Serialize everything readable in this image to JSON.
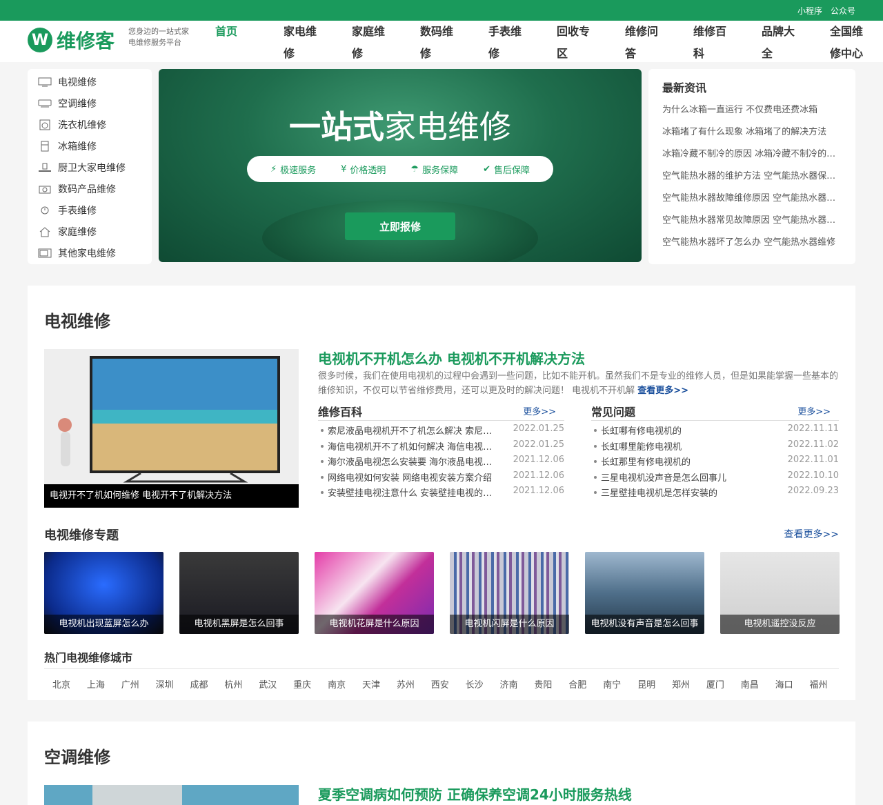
{
  "topbar": {
    "miniprogram": "小程序",
    "official": "公众号"
  },
  "brand": {
    "logo_letter": "W",
    "name": "维修客",
    "slogan": "您身边的一站式家电维修服务平台"
  },
  "nav": [
    "首页",
    "家电维修",
    "家庭维修",
    "数码维修",
    "手表维修",
    "回收专区",
    "维修问答",
    "维修百科",
    "品牌大全",
    "全国维修中心"
  ],
  "categories": [
    {
      "icon": "tv-icon",
      "label": "电视维修"
    },
    {
      "icon": "air-conditioner-icon",
      "label": "空调维修"
    },
    {
      "icon": "washing-machine-icon",
      "label": "洗衣机维修"
    },
    {
      "icon": "fridge-icon",
      "label": "冰箱维修"
    },
    {
      "icon": "stove-icon",
      "label": "厨卫大家电维修"
    },
    {
      "icon": "camera-icon",
      "label": "数码产品维修"
    },
    {
      "icon": "watch-icon",
      "label": "手表维修"
    },
    {
      "icon": "house-icon",
      "label": "家庭维修"
    },
    {
      "icon": "microwave-icon",
      "label": "其他家电维修"
    }
  ],
  "banner": {
    "title_bold": "一站式",
    "title_rest": "家电维修",
    "features": [
      "极速服务",
      "价格透明",
      "服务保障",
      "售后保障"
    ],
    "button": "立即报修"
  },
  "news": {
    "title": "最新资讯",
    "items": [
      "为什么冰箱一直运行 不仅费电还费冰箱",
      "冰箱堵了有什么现象 冰箱堵了的解决方法",
      "冰箱冷藏不制冷的原因 冰箱冷藏不制冷的解决方法",
      "空气能热水器的维护方法 空气能热水器保养方法",
      "空气能热水器故障维修原因 空气能热水器故障",
      "空气能热水器常见故障原因 空气能热水器故障",
      "空气能热水器坏了怎么办 空气能热水器维修"
    ]
  },
  "tv": {
    "section_title": "电视维修",
    "feature_caption": "电视开不了机如何维修 电视开不了机解决方法",
    "feature_title": "电视机不开机怎么办 电视机不开机解决方法",
    "feature_desc": "很多时候，我们在使用电视机的过程中会遇到一些问题，比如不能开机。虽然我们不是专业的维修人员，但是如果能掌握一些基本的维修知识，不仅可以节省维修费用，还可以更及时的解决问题！ 电视机不开机解",
    "feature_more": "查看更多>>",
    "wiki": {
      "title": "维修百科",
      "more": "更多>>",
      "items": [
        {
          "t": "索尼液晶电视机开不了机怎么解决 索尼液晶电视",
          "d": "2022.01.25"
        },
        {
          "t": "海信电视机开不了机如何解决 海信电视机不开机",
          "d": "2022.01.25"
        },
        {
          "t": "海尔液晶电视怎么安装要 海尔液晶电视安装方法",
          "d": "2021.12.06"
        },
        {
          "t": "网络电视如何安装 网络电视安装方案介绍",
          "d": "2021.12.06"
        },
        {
          "t": "安装壁挂电视注意什么 安装壁挂电视的注意事项",
          "d": "2021.12.06"
        }
      ]
    },
    "faq": {
      "title": "常见问题",
      "more": "更多>>",
      "items": [
        {
          "t": "长虹哪有修电视机的",
          "d": "2022.11.11"
        },
        {
          "t": "长虹哪里能修电视机",
          "d": "2022.11.02"
        },
        {
          "t": "长虹那里有修电视机的",
          "d": "2022.11.01"
        },
        {
          "t": "三星电视机没声音是怎么回事儿",
          "d": "2022.10.10"
        },
        {
          "t": "三星壁挂电视机是怎样安装的",
          "d": "2022.09.23"
        }
      ]
    },
    "topic_title": "电视维修专题",
    "topic_more": "查看更多>>",
    "topics": [
      "电视机出现蓝屏怎么办",
      "电视机黑屏是怎么回事",
      "电视机花屏是什么原因",
      "电视机闪屏是什么原因",
      "电视机没有声音是怎么回事",
      "电视机遥控没反应"
    ],
    "city_title": "热门电视维修城市",
    "cities": [
      "北京",
      "上海",
      "广州",
      "深圳",
      "成都",
      "杭州",
      "武汉",
      "重庆",
      "南京",
      "天津",
      "苏州",
      "西安",
      "长沙",
      "济南",
      "贵阳",
      "合肥",
      "南宁",
      "昆明",
      "郑州",
      "厦门",
      "南昌",
      "海口",
      "福州"
    ]
  },
  "ac": {
    "section_title": "空调维修",
    "feature_title": "夏季空调病如何预防 正确保养空调24小时服务热线"
  }
}
